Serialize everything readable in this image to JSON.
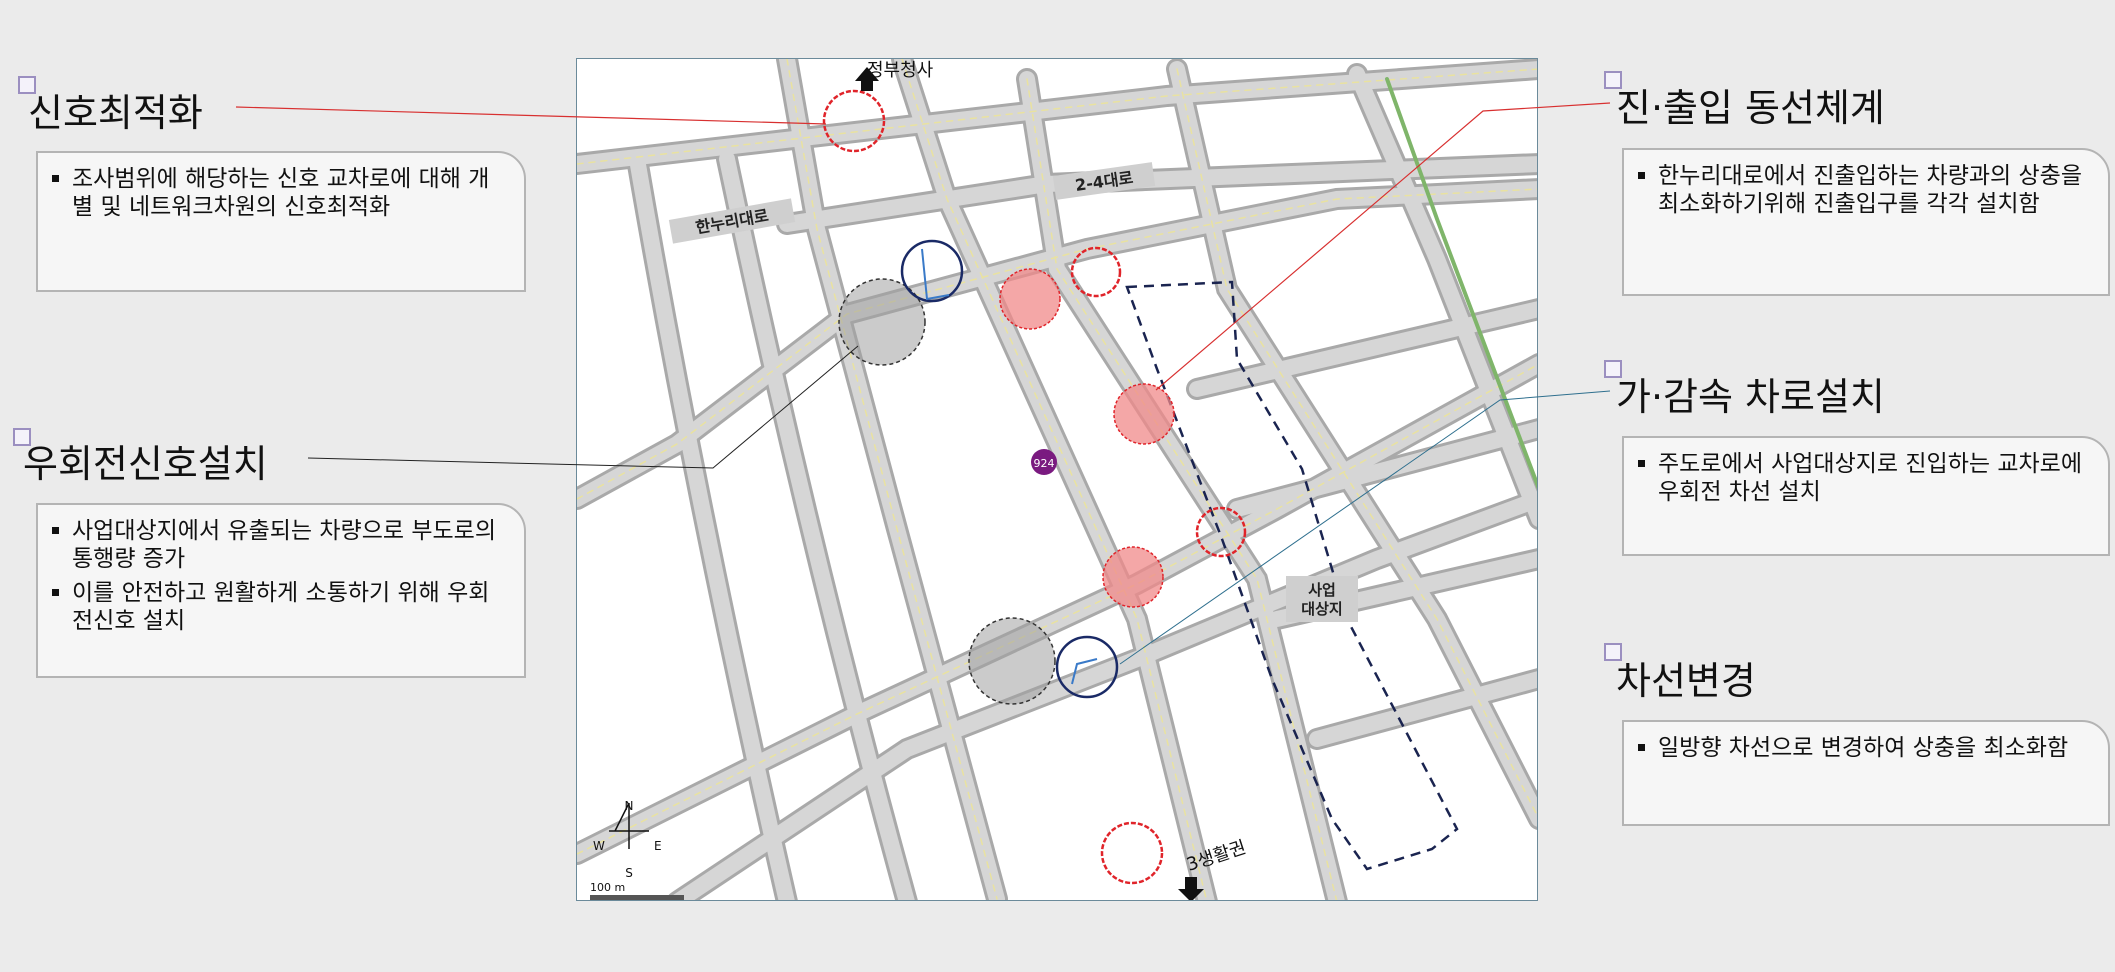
{
  "sections": [
    {
      "title": "신호최적화",
      "bullets": [
        "조사범위에 해당하는 신호  교차로에 대해 개별 및 네트워크차원의 신호최적화"
      ]
    },
    {
      "title": "우회전신호설치",
      "bullets": [
        "사업대상지에서 유출되는   차량으로 부도로의 통행량 증가",
        "이를 안전하고 원활하게 소통하기 위해 우회전신호 설치"
      ]
    },
    {
      "title": "진·출입 동선체계",
      "bullets": [
        "한누리대로에서 진출입하는 차량과의 상충을 최소화하기위해 진출입구를 각각 설치함"
      ]
    },
    {
      "title": "가·감속 차로설치",
      "bullets": [
        "주도로에서 사업대상지로 진입하는 교차로에 우회전 차선 설치"
      ]
    },
    {
      "title": "차선변경",
      "bullets": [
        "일방향 차선으로 변경하여  상충을 최소화함"
      ]
    }
  ],
  "map": {
    "road_label_1": "한누리대로",
    "road_label_2": "2-4대로",
    "site_label_line1": "사업",
    "site_label_line2": "대상지",
    "arrow_top_label": "정부청사",
    "arrow_bottom_label": "3생활권",
    "marker_label": "924",
    "compass_n": "N",
    "compass_s": "S",
    "compass_e": "E",
    "compass_w": "W",
    "scale_label": "100 m"
  },
  "colors": {
    "signal_circle": "#e0242a",
    "turn_circle": "#1a2a66",
    "gray_circle": "#9a9a9a",
    "pink_fill": "#f08a8a",
    "road_fill": "#d2d2d2",
    "marker": "#7a1a80"
  }
}
